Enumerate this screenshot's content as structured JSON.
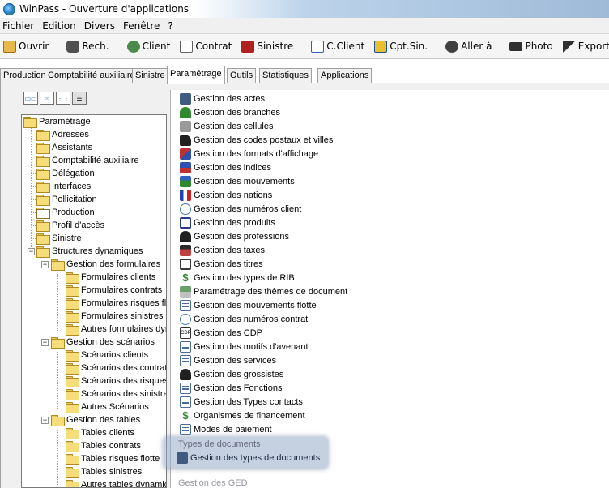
{
  "window": {
    "title": "WinPass - Ouverture d'applications"
  },
  "menu": [
    "Fichier",
    "Edition",
    "Divers",
    "Fenêtre",
    "?"
  ],
  "toolbar": [
    {
      "label": "Ouvrir",
      "icon": "folder-open-icon",
      "color": "#d9a02a"
    },
    {
      "label": "Rech.",
      "icon": "binoculars-icon",
      "color": "#404040"
    },
    {
      "label": "Client",
      "icon": "client-icon",
      "color": "#3a7a3a"
    },
    {
      "label": "Contrat",
      "icon": "contract-icon",
      "color": "#707070"
    },
    {
      "label": "Sinistre",
      "icon": "car-icon",
      "color": "#b02020"
    },
    {
      "label": "C.Client",
      "icon": "cclient-icon",
      "color": "#3060b0"
    },
    {
      "label": "Cpt.Sin.",
      "icon": "cptsin-icon",
      "color": "#e0b020"
    },
    {
      "label": "Aller à",
      "icon": "goto-icon",
      "color": "#303030"
    },
    {
      "label": "Photo",
      "icon": "camera-icon",
      "color": "#303030"
    },
    {
      "label": "Exporte",
      "icon": "export-icon",
      "color": "#303030"
    }
  ],
  "tabs": [
    "Production",
    "Comptabilité auxiliaire",
    "Sinistre",
    "Paramétrage",
    "Outils",
    "Statistiques",
    "Applications"
  ],
  "active_tab": "Paramétrage",
  "tree": [
    "Paramétrage",
    "Adresses",
    "Assistants",
    "Comptabilité auxiliaire",
    "Délégation",
    "Interfaces",
    "Pollicitation",
    "Production",
    "Profil d'accès",
    "Sinistre",
    "Structures dynamiques",
    "Gestion des formulaires",
    "Formulaires clients",
    "Formulaires contrats",
    "Formulaires risques flot",
    "Formulaires sinistres",
    "Autres formulaires dyna",
    "Gestion des scénarios",
    "Scénarios clients",
    "Scénarios des contrats",
    "Scénarios des risques",
    "Scénarios des sinistres",
    "Autres Scénarios",
    "Gestion des tables",
    "Tables clients",
    "Tables contrats",
    "Tables risques flotte",
    "Tables sinistres",
    "Autres tables dynamiqu"
  ],
  "list": [
    {
      "label": "Gestion des actes",
      "icon": "actes-icon",
      "color": "#405a80"
    },
    {
      "label": "Gestion des branches",
      "icon": "tree-icon",
      "color": "#2f8a2f"
    },
    {
      "label": "Gestion des cellules",
      "icon": "cells-icon",
      "color": "#8a8a8a"
    },
    {
      "label": "Gestion des codes postaux et villes",
      "icon": "postal-icon",
      "color": "#202020"
    },
    {
      "label": "Gestion des formats d'affichage",
      "icon": "format-icon",
      "color": "#c03030"
    },
    {
      "label": "Gestion des indices",
      "icon": "indices-icon",
      "color": "#3050b0"
    },
    {
      "label": "Gestion des mouvements",
      "icon": "movements-icon",
      "color": "#2f8a2f"
    },
    {
      "label": "Gestion des nations",
      "icon": "flag-icon",
      "color": "#d02020"
    },
    {
      "label": "Gestion des numéros client",
      "icon": "numbers-icon",
      "color": "#4a7ab0"
    },
    {
      "label": "Gestion des produits",
      "icon": "product-icon",
      "color": "#2a3a8a"
    },
    {
      "label": "Gestion des professions",
      "icon": "profession-icon",
      "color": "#202020"
    },
    {
      "label": "Gestion des taxes",
      "icon": "taxes-icon",
      "color": "#c04040"
    },
    {
      "label": "Gestion des titres",
      "icon": "titles-icon",
      "color": "#3a3a3a"
    },
    {
      "label": "Gestion des types de RIB",
      "icon": "dollar-icon",
      "color": "#2f8a2f"
    },
    {
      "label": "Paramétrage des thèmes de document",
      "icon": "theme-icon",
      "color": "#5a8a5a"
    },
    {
      "label": "Gestion des mouvements flotte",
      "icon": "doc-icon",
      "color": "#4a6a9a"
    },
    {
      "label": "Gestion des numéros contrat",
      "icon": "contract-numbers-icon",
      "color": "#4a7ab0"
    },
    {
      "label": "Gestion des CDP",
      "icon": "cdp-icon",
      "color": "#303030"
    },
    {
      "label": "Gestion des motifs d'avenant",
      "icon": "doc-icon",
      "color": "#4a6a9a"
    },
    {
      "label": "Gestion des services",
      "icon": "doc-icon",
      "color": "#4a6a9a"
    },
    {
      "label": "Gestion des grossistes",
      "icon": "wholesaler-icon",
      "color": "#202020"
    },
    {
      "label": "Gestion des Fonctions",
      "icon": "doc-icon",
      "color": "#4a6a9a"
    },
    {
      "label": "Gestion des Types contacts",
      "icon": "doc-icon",
      "color": "#4a6a9a"
    },
    {
      "label": "Organismes de financement",
      "icon": "dollar-icon",
      "color": "#2f8a2f"
    },
    {
      "label": "Modes de paiement",
      "icon": "doc-icon",
      "color": "#4a6a9a"
    }
  ],
  "faded_above": "Types de documents",
  "highlighted": {
    "label": "Gestion des types de documents",
    "icon": "actes-icon",
    "color": "#405a80"
  },
  "faded_below": "Gestion des GED"
}
